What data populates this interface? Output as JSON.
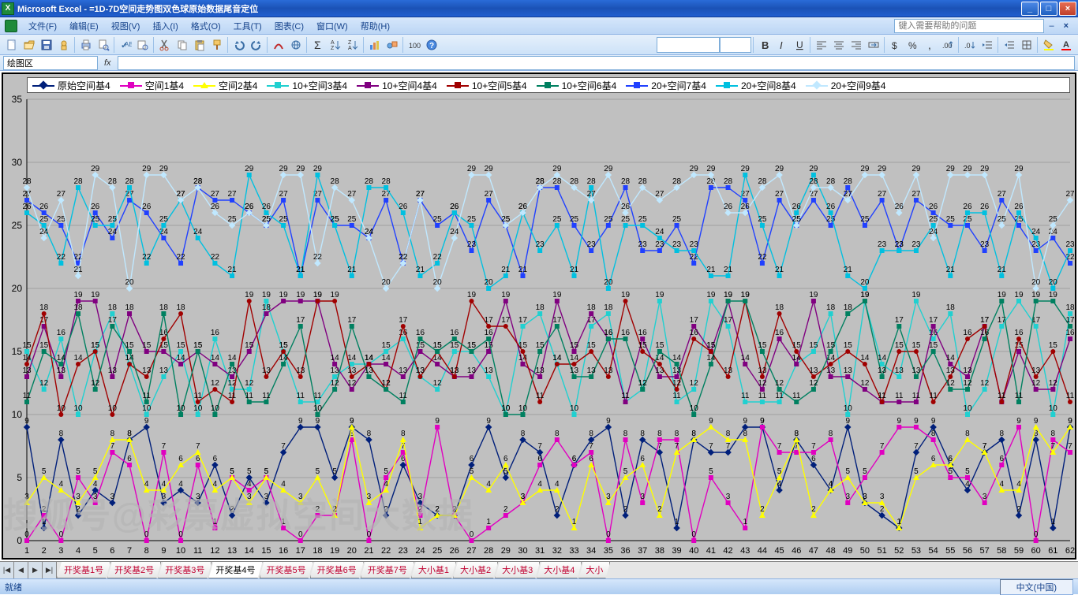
{
  "title": {
    "app": "Microsoft Excel",
    "separator": " - ",
    "document": "=1D-7D空间走势图双色球原始数据尾音定位"
  },
  "window_buttons": {
    "min": "_",
    "max": "□",
    "close": "×"
  },
  "menu": {
    "items": [
      "文件(F)",
      "编辑(E)",
      "视图(V)",
      "插入(I)",
      "格式(O)",
      "工具(T)",
      "图表(C)",
      "窗口(W)",
      "帮助(H)"
    ],
    "help_placeholder": "键入需要帮助的问题",
    "inner_close": "×"
  },
  "toolbar1": {
    "icons": [
      "new-doc",
      "open",
      "save",
      "permission",
      "print",
      "print-preview",
      "spelling",
      "research",
      "cut",
      "copy",
      "paste",
      "format-painter",
      "undo",
      "redo",
      "ink",
      "hyperlink",
      "autosum",
      "sort-asc",
      "sort-desc",
      "chart-wizard",
      "drawing",
      "zoom",
      "help"
    ]
  },
  "toolbar2": {
    "font_name": "",
    "font_size": "",
    "icons": [
      "bold",
      "italic",
      "underline",
      "align-left",
      "align-center",
      "align-right",
      "merge",
      "currency",
      "percent",
      "comma",
      "inc-dec",
      "dec-dec",
      "dec-indent",
      "inc-indent",
      "borders",
      "fill-color",
      "font-color"
    ]
  },
  "formula": {
    "namebox": "绘图区",
    "fx": "fx",
    "value": ""
  },
  "chart_data": {
    "type": "line",
    "title": "",
    "xlabel": "",
    "ylabel": "",
    "ylim": [
      0,
      35
    ],
    "yticks": [
      0,
      5,
      10,
      15,
      20,
      25,
      30,
      35
    ],
    "x": [
      1,
      2,
      3,
      4,
      5,
      6,
      7,
      8,
      9,
      10,
      11,
      12,
      13,
      14,
      15,
      16,
      17,
      18,
      19,
      20,
      21,
      22,
      23,
      24,
      25,
      26,
      27,
      28,
      29,
      30,
      31,
      32,
      33,
      34,
      35,
      36,
      37,
      38,
      39,
      40,
      41,
      42,
      43,
      44,
      45,
      46,
      47,
      48,
      49,
      50,
      51,
      52,
      53,
      54,
      55,
      56,
      57,
      58,
      59,
      60,
      61,
      62
    ],
    "series": [
      {
        "name": "原始空间基4",
        "color": "#001f7a",
        "marker": "diamond",
        "values": [
          9,
          1,
          8,
          2,
          4,
          3,
          8,
          9,
          3,
          4,
          3,
          6,
          2,
          5,
          3,
          7,
          9,
          9,
          5,
          9,
          8,
          2,
          6,
          3,
          2,
          2,
          6,
          9,
          5,
          8,
          7,
          2,
          6,
          8,
          9,
          2,
          8,
          7,
          1,
          8,
          7,
          7,
          9,
          9,
          4,
          8,
          6,
          4,
          9,
          3,
          2,
          1,
          7,
          9,
          6,
          4,
          7,
          8,
          2,
          8,
          1,
          9
        ],
        "show_labels": true
      },
      {
        "name": "空间1基4",
        "color": "#e000c0",
        "marker": "square",
        "values": [
          0,
          2,
          0,
          5,
          3,
          7,
          6,
          0,
          7,
          0,
          6,
          1,
          5,
          4,
          5,
          1,
          0,
          2,
          2,
          8,
          0,
          5,
          7,
          2,
          9,
          2,
          0,
          1,
          2,
          3,
          6,
          8,
          6,
          7,
          0,
          8,
          3,
          8,
          8,
          0,
          5,
          3,
          1,
          9,
          7,
          7,
          7,
          8,
          3,
          5,
          7,
          9,
          9,
          8,
          5,
          5,
          3,
          6,
          9,
          0,
          8,
          7
        ],
        "show_labels": true
      },
      {
        "name": "空间2基4",
        "color": "#ffff00",
        "marker": "triangle",
        "values": [
          3,
          5,
          4,
          3,
          5,
          8,
          8,
          4,
          4,
          6,
          7,
          4,
          5,
          3,
          5,
          4,
          3,
          5,
          2,
          9,
          3,
          4,
          8,
          1,
          2,
          2,
          5,
          4,
          6,
          3,
          4,
          4,
          1,
          6,
          3,
          5,
          6,
          2,
          7,
          8,
          9,
          8,
          8,
          2,
          5,
          8,
          2,
          4,
          5,
          3,
          3,
          1,
          5,
          6,
          6,
          8,
          7,
          4,
          4,
          9,
          7,
          9
        ],
        "show_labels": true
      },
      {
        "name": "10+空间3基4",
        "color": "#20d0d0",
        "marker": "x",
        "values": [
          15,
          12,
          16,
          10,
          15,
          18,
          14,
          10,
          13,
          15,
          10,
          16,
          12,
          12,
          19,
          15,
          11,
          11,
          13,
          14,
          14,
          15,
          16,
          13,
          12,
          15,
          15,
          13,
          10,
          17,
          18,
          14,
          10,
          17,
          18,
          11,
          12,
          19,
          11,
          12,
          19,
          17,
          11,
          11,
          11,
          14,
          15,
          18,
          10,
          19,
          14,
          13,
          19,
          16,
          18,
          10,
          12,
          17,
          19,
          17,
          10,
          18
        ],
        "show_labels": true
      },
      {
        "name": "10+空间4基4",
        "color": "#800080",
        "marker": "star",
        "values": [
          13,
          17,
          13,
          19,
          19,
          13,
          18,
          15,
          15,
          14,
          15,
          14,
          13,
          15,
          18,
          19,
          19,
          19,
          14,
          12,
          14,
          14,
          13,
          15,
          14,
          13,
          13,
          15,
          19,
          14,
          13,
          19,
          15,
          18,
          16,
          11,
          16,
          13,
          13,
          17,
          15,
          19,
          14,
          12,
          16,
          14,
          19,
          13,
          13,
          12,
          11,
          11,
          11,
          17,
          14,
          13,
          17,
          11,
          15,
          12,
          12,
          16
        ],
        "show_labels": true
      },
      {
        "name": "10+空间5基4",
        "color": "#a00000",
        "marker": "circle",
        "values": [
          14,
          18,
          10,
          14,
          15,
          10,
          14,
          13,
          16,
          18,
          11,
          12,
          11,
          19,
          13,
          15,
          13,
          19,
          19,
          13,
          14,
          12,
          17,
          13,
          15,
          13,
          19,
          17,
          17,
          15,
          11,
          14,
          14,
          15,
          13,
          19,
          15,
          14,
          12,
          16,
          15,
          13,
          19,
          13,
          18,
          15,
          13,
          14,
          15,
          14,
          11,
          15,
          15,
          11,
          13,
          16,
          17,
          11,
          16,
          13,
          15,
          11
        ],
        "show_labels": true
      },
      {
        "name": "10+空间6基4",
        "color": "#008060",
        "marker": "plus",
        "values": [
          11,
          15,
          14,
          18,
          12,
          17,
          15,
          11,
          18,
          10,
          15,
          10,
          14,
          11,
          11,
          14,
          17,
          10,
          12,
          17,
          13,
          12,
          11,
          16,
          15,
          16,
          15,
          16,
          10,
          10,
          15,
          17,
          13,
          13,
          16,
          16,
          12,
          15,
          14,
          10,
          14,
          19,
          19,
          15,
          12,
          11,
          12,
          15,
          18,
          19,
          13,
          17,
          13,
          15,
          12,
          12,
          16,
          19,
          11,
          19,
          19,
          17
        ],
        "show_labels": true
      },
      {
        "name": "20+空间7基4",
        "color": "#2040ff",
        "marker": "dash",
        "values": [
          27,
          26,
          25,
          22,
          26,
          24,
          27,
          26,
          24,
          22,
          28,
          27,
          27,
          26,
          25,
          27,
          21,
          27,
          25,
          25,
          24,
          27,
          22,
          27,
          25,
          26,
          23,
          27,
          25,
          21,
          28,
          28,
          25,
          23,
          25,
          28,
          23,
          23,
          25,
          22,
          28,
          28,
          27,
          22,
          27,
          25,
          27,
          25,
          28,
          25,
          27,
          23,
          27,
          26,
          25,
          25,
          23,
          27,
          25,
          23,
          24,
          22
        ],
        "show_labels": true
      },
      {
        "name": "20+空间8基4",
        "color": "#00c0e0",
        "marker": "dash",
        "values": [
          26,
          25,
          22,
          28,
          25,
          25,
          28,
          22,
          25,
          27,
          24,
          22,
          21,
          29,
          26,
          25,
          21,
          29,
          25,
          21,
          28,
          28,
          26,
          21,
          22,
          26,
          25,
          20,
          21,
          26,
          23,
          25,
          21,
          28,
          20,
          25,
          25,
          24,
          23,
          23,
          21,
          21,
          29,
          25,
          21,
          26,
          29,
          26,
          21,
          20,
          23,
          23,
          23,
          25,
          21,
          26,
          26,
          21,
          26,
          24,
          20,
          23
        ],
        "show_labels": true
      },
      {
        "name": "20+空间9基4",
        "color": "#c0e8ff",
        "marker": "diamond",
        "values": [
          28,
          24,
          27,
          21,
          29,
          28,
          20,
          29,
          29,
          27,
          28,
          26,
          25,
          26,
          25,
          29,
          29,
          22,
          28,
          27,
          24,
          20,
          22,
          27,
          20,
          24,
          29,
          29,
          25,
          26,
          28,
          29,
          28,
          27,
          29,
          26,
          28,
          27,
          28,
          29,
          29,
          26,
          26,
          28,
          29,
          25,
          28,
          28,
          27,
          29,
          29,
          26,
          29,
          24,
          29,
          29,
          29,
          25,
          29,
          20,
          25,
          27
        ],
        "show_labels": true
      }
    ],
    "data_labels": "above",
    "legend_position": "top",
    "grid": true,
    "plot_bg": "#c0c0c0"
  },
  "sheet_tabs": {
    "nav": [
      "|◀",
      "◀",
      "▶",
      "▶|"
    ],
    "tabs": [
      "开奖基1号",
      "开奖基2号",
      "开奖基3号",
      "开奖基4号",
      "开奖基5号",
      "开奖基6号",
      "开奖基7号",
      "大小基1",
      "大小基2",
      "大小基3",
      "大小基4",
      "大小"
    ],
    "selected_index": 3
  },
  "status": {
    "ready": "就绪",
    "lang": "中文(中国)"
  },
  "watermark": "搜狐号@彩票虚拟空间大数据"
}
